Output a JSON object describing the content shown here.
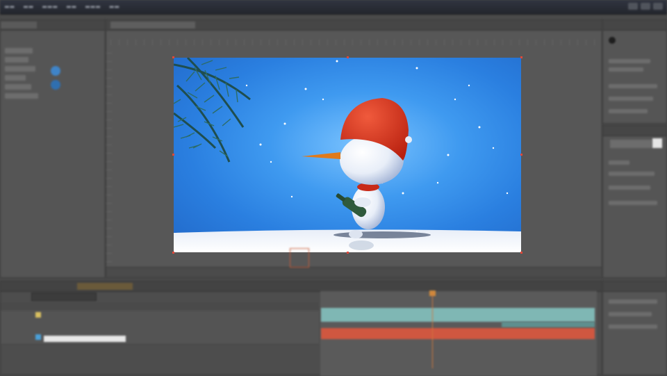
{
  "colors": {
    "panel_bg": "#555555",
    "viewer_bg": "#2a7fe0",
    "snowman_hat": "#d8321e",
    "carrot": "#e07a1a",
    "teal_bar": "#7fb7b4",
    "red_bar": "#d05740",
    "playhead": "#d4783c"
  },
  "icons": {
    "workspace_icon": "circle-icon",
    "close_icon": "close-icon"
  }
}
